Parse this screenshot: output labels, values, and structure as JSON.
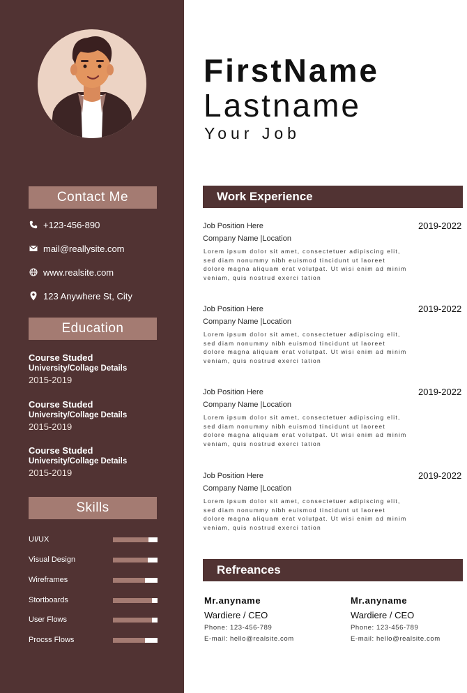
{
  "header": {
    "first_name": "FirstName",
    "last_name": "Lastname",
    "job_title": "Your Job"
  },
  "contact": {
    "heading": "Contact Me",
    "phone": "+123-456-890",
    "email": "mail@reallysite.com",
    "website": "www.realsite.com",
    "address": "123 Anywhere St, City"
  },
  "education": {
    "heading": "Education",
    "items": [
      {
        "course": "Course Studed",
        "university": "University/Collage Details",
        "years": "2015-2019"
      },
      {
        "course": "Course Studed",
        "university": "University/Collage Details",
        "years": "2015-2019"
      },
      {
        "course": "Course Studed",
        "university": "University/Collage Details",
        "years": "2015-2019"
      }
    ]
  },
  "skills": {
    "heading": "Skills",
    "items": [
      {
        "name": "UI/UX",
        "level": 0.8
      },
      {
        "name": "Visual Design",
        "level": 0.78
      },
      {
        "name": "Wireframes",
        "level": 0.72
      },
      {
        "name": "Stortboards",
        "level": 0.88
      },
      {
        "name": "User Flows",
        "level": 0.88
      },
      {
        "name": "Procss Flows",
        "level": 0.72
      }
    ]
  },
  "work": {
    "heading": "Work Experience",
    "items": [
      {
        "position": "Job Position Here",
        "company": "Company Name |Location",
        "dates": "2019-2022",
        "description": "Lorem ipsum dolor sit amet, consectetuer adipiscing elit,\nsed diam nonummy nibh euismod tincidunt ut laoreet\ndolore magna aliquam erat volutpat. Ut wisi enim ad minim\nveniam, quis nostrud exerci tation"
      },
      {
        "position": "Job Position Here",
        "company": "Company Name |Location",
        "dates": "2019-2022",
        "description": "Lorem ipsum dolor sit amet, consectetuer adipiscing elit,\nsed diam nonummy nibh euismod tincidunt ut laoreet\ndolore magna aliquam erat volutpat. Ut wisi enim ad minim\nveniam, quis nostrud exerci tation"
      },
      {
        "position": "Job Position Here",
        "company": "Company Name |Location",
        "dates": "2019-2022",
        "description": "Lorem ipsum dolor sit amet, consectetuer adipiscing elit,\nsed diam nonummy nibh euismod tincidunt ut laoreet\ndolore magna aliquam erat volutpat. Ut wisi enim ad minim\nveniam, quis nostrud exerci tation"
      },
      {
        "position": "Job Position Here",
        "company": "Company Name |Location",
        "dates": "2019-2022",
        "description": "Lorem ipsum dolor sit amet, consectetuer adipiscing elit,\nsed diam nonummy nibh euismod tincidunt ut laoreet\ndolore magna aliquam erat volutpat. Ut wisi enim ad minim\nveniam, quis nostrud exerci tation"
      }
    ]
  },
  "references": {
    "heading": "Refreances",
    "items": [
      {
        "name": "Mr.anyname",
        "title": "Wardiere / CEO",
        "phone": "Phone: 123-456-789",
        "email": "E-mail: hello@realsite.com"
      },
      {
        "name": "Mr.anyname",
        "title": "Wardiere / CEO",
        "phone": "Phone: 123-456-789",
        "email": "E-mail: hello@realsite.com"
      }
    ]
  },
  "colors": {
    "sidebar": "#513333",
    "accent": "#a47b72",
    "avatar_bg": "#ecd3c4",
    "text": "#111111"
  },
  "icons": {
    "phone": "phone-icon",
    "email": "envelope-icon",
    "website": "globe-icon",
    "address": "map-pin-icon"
  }
}
